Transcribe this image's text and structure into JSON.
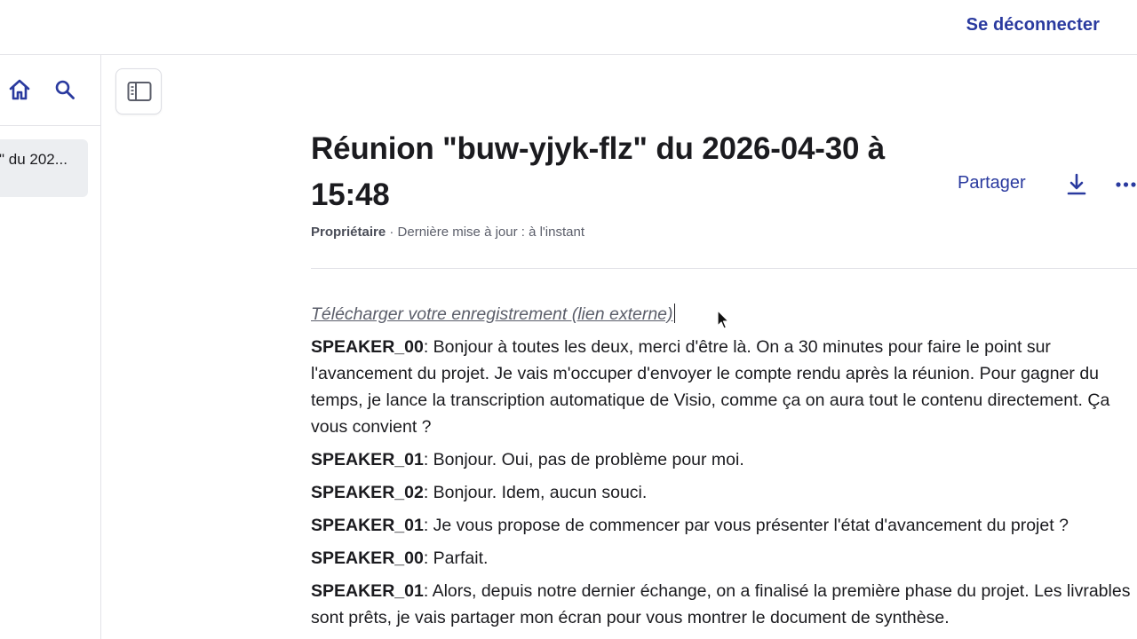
{
  "header": {
    "logout_label": "Se déconnecter"
  },
  "sidebar": {
    "icons": {
      "home": "home-icon",
      "search": "search-icon"
    },
    "docs": [
      {
        "label": "Réunion \"buw-yjyk-flz\" du 2026-04-30 à 15:48",
        "visible_text": "\" du 202..."
      }
    ]
  },
  "toolbar": {
    "toggle_icon": "sidebar-toggle-icon"
  },
  "document": {
    "title": "Réunion \"buw-yjyk-flz\" du 2026-04-30 à 15:48",
    "role": "Propriétaire",
    "updated": " · Dernière mise à jour : à l'instant",
    "share_label": "Partager",
    "download_icon": "download-icon",
    "more_icon": "more-icon"
  },
  "content": {
    "external_link": "Télécharger votre enregistrement (lien externe)",
    "transcript": [
      {
        "speaker": "SPEAKER_00",
        "text": ": Bonjour à toutes les deux, merci d'être là. On a 30 minutes pour faire le point sur l'avancement du projet. Je vais m'occuper d'envoyer le compte rendu après la réunion. Pour gagner du temps, je lance la transcription automatique de Visio, comme ça on aura tout le contenu directement. Ça vous convient ?"
      },
      {
        "speaker": "SPEAKER_01",
        "text": ": Bonjour. Oui, pas de problème pour moi."
      },
      {
        "speaker": "SPEAKER_02",
        "text": ": Bonjour. Idem, aucun souci."
      },
      {
        "speaker": "SPEAKER_01",
        "text": ": Je vous propose de commencer par vous présenter l'état d'avancement du projet ?"
      },
      {
        "speaker": "SPEAKER_00",
        "text": ": Parfait."
      },
      {
        "speaker": "SPEAKER_01",
        "text": ": Alors, depuis notre dernier échange, on a finalisé la première phase du projet. Les livrables sont prêts, je vais partager mon écran pour vous montrer le document de synthèse."
      }
    ]
  },
  "colors": {
    "accent": "#2a3a9f",
    "text": "#1b1b1f",
    "muted": "#5b5e6a",
    "border": "#e3e3e8",
    "selected_bg": "#eceef1"
  }
}
